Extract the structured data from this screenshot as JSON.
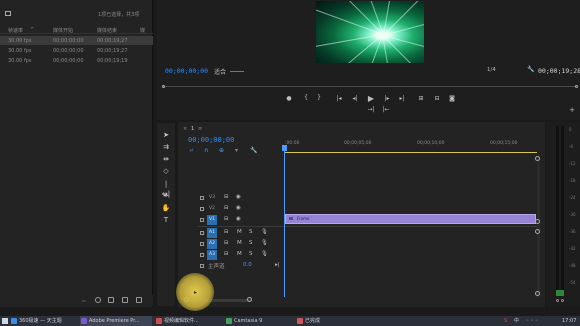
{
  "project_panel": {
    "header_icon": "folder-icon",
    "selection_text": "1项已选择，共3项",
    "columns": [
      "帧速率",
      "媒体开始",
      "媒体结束",
      "媒"
    ],
    "rows": [
      {
        "fps": "30.00 fps",
        "start": "00;00;00;00",
        "end": "00;00;19;27"
      },
      {
        "fps": "30.00 fps",
        "start": "00;00;00;00",
        "end": "00;00;19;27"
      },
      {
        "fps": "30.00 fps",
        "start": "00;00;00;00",
        "end": "00;00;19;19"
      }
    ],
    "footer_tools": [
      "list-view-icon",
      "search-icon",
      "new-bin-icon",
      "new-item-icon",
      "delete-icon"
    ]
  },
  "program_monitor": {
    "timecode": "00;00;00;00",
    "fit_label": "适合",
    "resolution": "1/4",
    "duration": "00;00;19;28",
    "transport": [
      "marker-icon",
      "in-point-icon",
      "out-point-icon",
      "go-to-in-icon",
      "step-back-icon",
      "play-icon",
      "step-forward-icon",
      "go-to-out-icon",
      "lift-icon",
      "extract-icon",
      "export-frame-icon"
    ],
    "transport_row2": [
      "insert-icon",
      "overwrite-icon"
    ],
    "add_label": "+"
  },
  "timeline": {
    "tab": "1",
    "timecode": "00;00;00;00",
    "ruler": [
      ":00:00",
      "00;00;05;00",
      "00;00;10;00",
      "00;00;15;00"
    ],
    "video_tracks": [
      {
        "name": "V3",
        "on": false
      },
      {
        "name": "V2",
        "on": false
      },
      {
        "name": "V1",
        "on": true
      }
    ],
    "audio_tracks": [
      {
        "name": "A1",
        "on": true,
        "m": "M",
        "s": "S"
      },
      {
        "name": "A2",
        "on": true,
        "m": "M",
        "s": "S"
      },
      {
        "name": "A3",
        "on": true,
        "m": "M",
        "s": "S"
      }
    ],
    "master": {
      "label": "主声道",
      "value": "0.0"
    },
    "clip_name": "Frame",
    "colors": {
      "clip": "#9683d6",
      "playhead": "#4f9aff",
      "in_out_bar": "#d8c64a"
    }
  },
  "tools": [
    "selection-tool-icon",
    "track-select-icon",
    "ripple-edit-icon",
    "razor-icon",
    "slip-icon",
    "pen-icon",
    "hand-icon",
    "zoom-icon",
    "type-icon"
  ],
  "meter": {
    "labels": [
      "0",
      "-6",
      "-12",
      "-18",
      "-24",
      "-30",
      "-36",
      "-42",
      "-48",
      "-54"
    ]
  },
  "taskbar": {
    "items": [
      {
        "label": "360极速 — 天主题",
        "color": "#3a8ee6"
      },
      {
        "label": "Adobe Premiere Pr...",
        "color": "#7b5ad6"
      },
      {
        "label": "视频编辑软件...",
        "color": "#d44d4d"
      },
      {
        "label": "Camtasia 9",
        "color": "#46a05a"
      },
      {
        "label": "已完成",
        "color": "#d45757"
      }
    ],
    "ime": "中",
    "clock": "17:07"
  }
}
